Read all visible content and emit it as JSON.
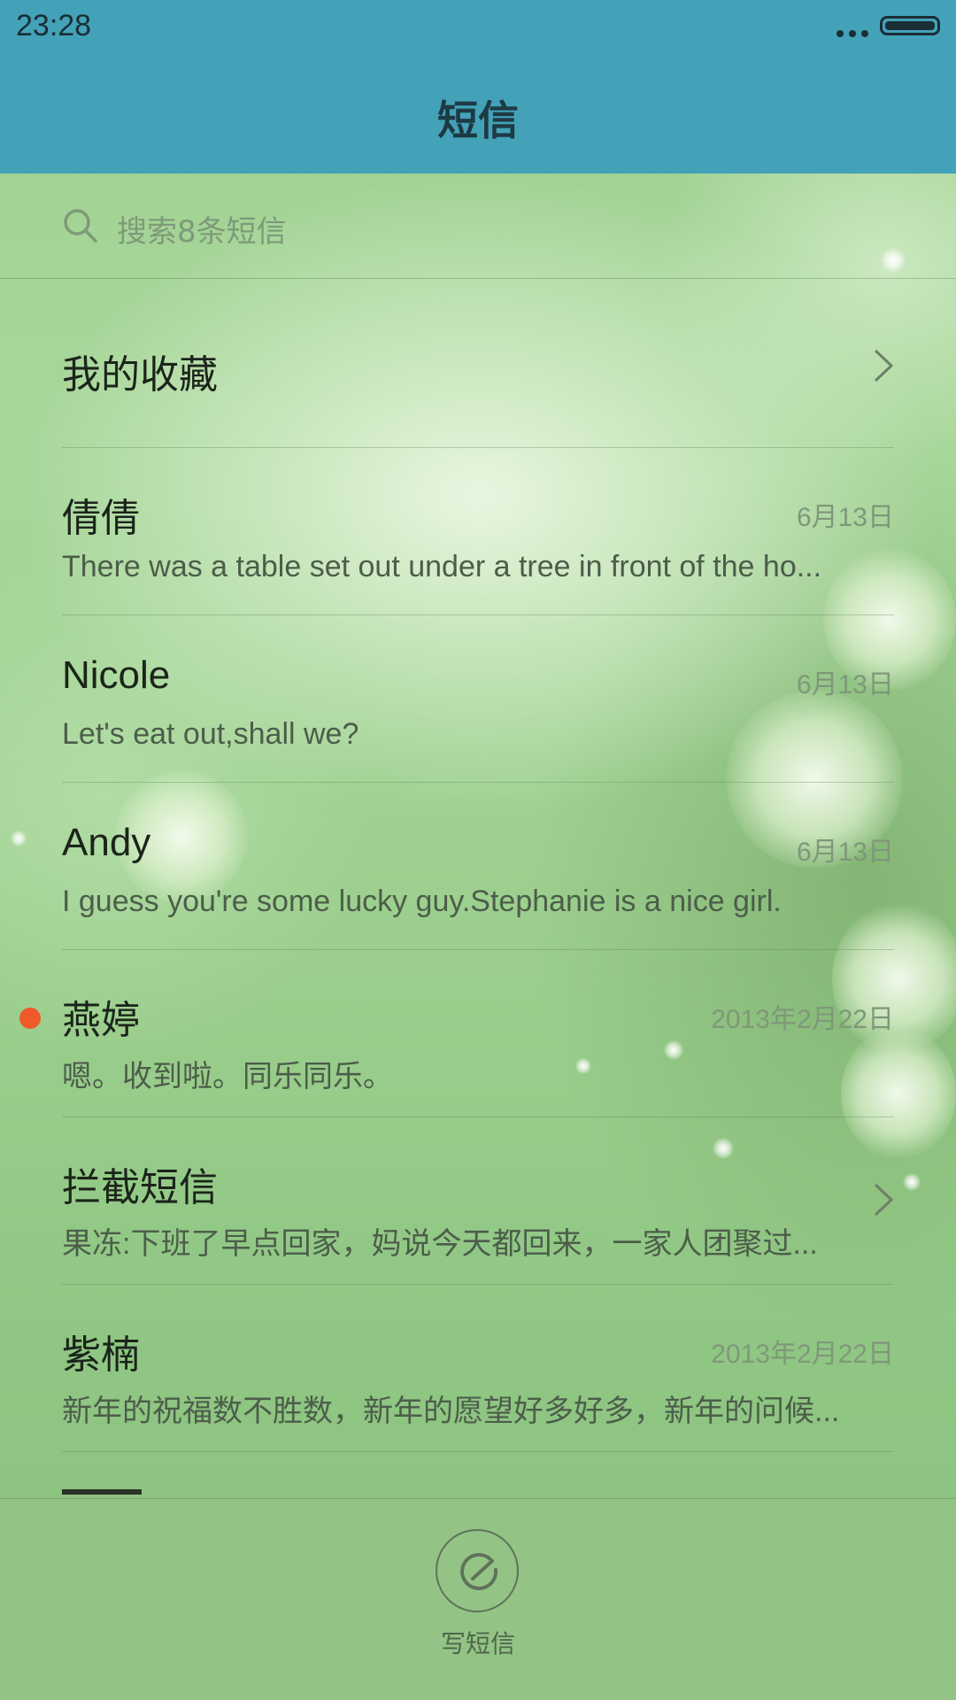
{
  "status_bar": {
    "time": "23:28"
  },
  "header": {
    "title": "短信"
  },
  "search": {
    "placeholder": "搜索8条短信",
    "icon": "search-icon"
  },
  "favorites": {
    "label": "我的收藏",
    "icon": "chevron-right-icon"
  },
  "conversations": [
    {
      "name": "倩倩",
      "date": "6月13日",
      "preview": "There was a table set out under a tree in front of the ho...",
      "unread": false
    },
    {
      "name": "Nicole",
      "date": "6月13日",
      "preview": "Let's eat out,shall we?",
      "unread": false
    },
    {
      "name": "Andy",
      "date": "6月13日",
      "preview": "I guess you're some lucky guy.Stephanie is a nice girl.",
      "unread": false
    },
    {
      "name": "燕婷",
      "date": "2013年2月22日",
      "preview": "嗯。收到啦。同乐同乐。",
      "unread": true
    },
    {
      "name": "拦截短信",
      "date": "",
      "preview": "果冻:下班了早点回家，妈说今天都回来，一家人团聚过...",
      "unread": false,
      "has_chevron": true
    },
    {
      "name": "紫楠",
      "date": "2013年2月22日",
      "preview": "新年的祝福数不胜数，新年的愿望好多好多，新年的问候...",
      "unread": false
    }
  ],
  "bottom_bar": {
    "compose_label": "写短信",
    "icon": "compose-icon"
  },
  "colors": {
    "header_bg": "#43a2b8",
    "unread_dot": "#f0592b",
    "list_bg": "#9fd090"
  }
}
